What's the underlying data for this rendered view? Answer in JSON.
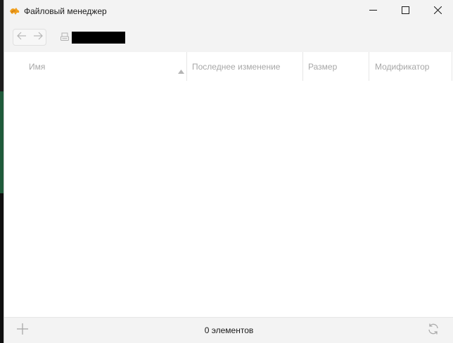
{
  "window": {
    "title": "Файловый менеджер"
  },
  "icons": {
    "app": "file-manager-app-icon",
    "minimize": "minimize-icon",
    "maximize": "maximize-icon",
    "close": "close-icon",
    "back": "arrow-left-icon",
    "forward": "arrow-right-icon",
    "drive": "drive-icon",
    "sort": "sort-ascending-icon",
    "add": "plus-icon",
    "refresh": "refresh-icon"
  },
  "toolbar": {
    "path": ""
  },
  "table": {
    "columns": [
      {
        "label": "Имя"
      },
      {
        "label": "Последнее изменение"
      },
      {
        "label": "Размер"
      },
      {
        "label": "Модификатор"
      }
    ],
    "rows": []
  },
  "status": {
    "count_text": "0 элементов"
  },
  "colors": {
    "accent": "#f0a020",
    "chrome": "#f3f3f3",
    "header_text": "#a7a7a7"
  }
}
